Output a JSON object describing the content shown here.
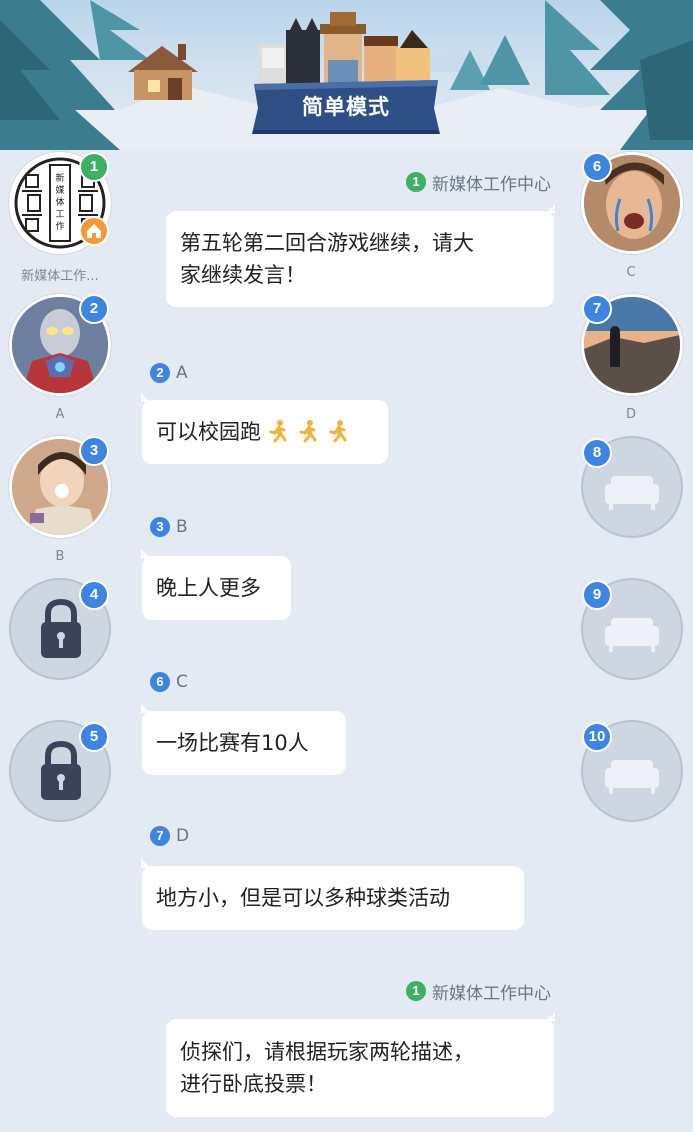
{
  "mode_title": "简单模式",
  "seats_left": [
    {
      "number": "1",
      "name": "新媒体工作...",
      "avatar": "newmedia-seal-avatar",
      "host": true,
      "badge_color": "#3fb063"
    },
    {
      "number": "2",
      "name": "A",
      "avatar": "ultraman-avatar"
    },
    {
      "number": "3",
      "name": "B",
      "avatar": "girl-photo-avatar"
    },
    {
      "number": "4",
      "name": "",
      "avatar": "lock-icon",
      "state": "locked"
    },
    {
      "number": "5",
      "name": "",
      "avatar": "lock-icon",
      "state": "locked"
    }
  ],
  "seats_right": [
    {
      "number": "6",
      "name": "C",
      "avatar": "crying-face-avatar"
    },
    {
      "number": "7",
      "name": "D",
      "avatar": "landscape-photo-avatar"
    },
    {
      "number": "8",
      "name": "",
      "avatar": "sofa-icon",
      "state": "empty"
    },
    {
      "number": "9",
      "name": "",
      "avatar": "sofa-icon",
      "state": "empty"
    },
    {
      "number": "10",
      "name": "",
      "avatar": "sofa-icon",
      "state": "empty"
    }
  ],
  "messages": [
    {
      "sender_number": "1",
      "sender_name": "新媒体工作中心",
      "text_lines": [
        "第五轮第二回合游戏继续，请大",
        "家继续发言！"
      ]
    },
    {
      "sender_number": "2",
      "sender_name": "A",
      "text": "可以校园跑",
      "emoji": "runner-emoji x3"
    },
    {
      "sender_number": "3",
      "sender_name": "B",
      "text": "晚上人更多"
    },
    {
      "sender_number": "6",
      "sender_name": "C",
      "text": "一场比赛有10人"
    },
    {
      "sender_number": "7",
      "sender_name": "D",
      "text": "地方小，但是可以多种球类活动"
    },
    {
      "sender_number": "1",
      "sender_name": "新媒体工作中心",
      "text_lines": [
        "侦探们，请根据玩家两轮描述，",
        "进行卧底投票！"
      ]
    }
  ],
  "colors": {
    "host_badge": "#3fb063",
    "player_badge": "#3d85e0",
    "background": "#e4eaf3",
    "bubble": "#ffffff",
    "banner": "#2e4f86",
    "home_badge": "#f39a36"
  }
}
